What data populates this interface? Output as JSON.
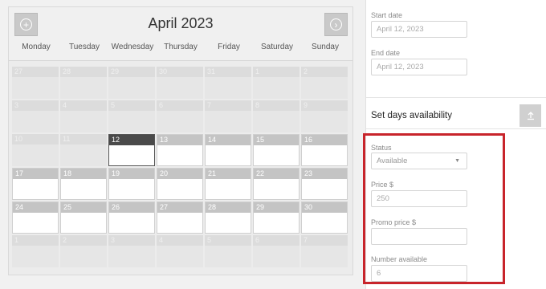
{
  "calendar": {
    "month_title": "April 2023",
    "prev_icon": "circle-plus-icon",
    "next_icon": "circle-arrow-right-icon",
    "weekdays": [
      "Monday",
      "Tuesday",
      "Wednesday",
      "Thursday",
      "Friday",
      "Saturday",
      "Sunday"
    ],
    "weeks": [
      [
        {
          "d": "27",
          "s": "muted"
        },
        {
          "d": "28",
          "s": "muted"
        },
        {
          "d": "29",
          "s": "muted"
        },
        {
          "d": "30",
          "s": "muted"
        },
        {
          "d": "31",
          "s": "muted"
        },
        {
          "d": "1",
          "s": "muted"
        },
        {
          "d": "2",
          "s": "muted"
        }
      ],
      [
        {
          "d": "3",
          "s": "muted"
        },
        {
          "d": "4",
          "s": "muted"
        },
        {
          "d": "5",
          "s": "muted"
        },
        {
          "d": "6",
          "s": "muted"
        },
        {
          "d": "7",
          "s": "muted"
        },
        {
          "d": "8",
          "s": "muted"
        },
        {
          "d": "9",
          "s": "muted"
        }
      ],
      [
        {
          "d": "10",
          "s": "muted"
        },
        {
          "d": "11",
          "s": "muted"
        },
        {
          "d": "12",
          "s": "today"
        },
        {
          "d": "13",
          "s": "active"
        },
        {
          "d": "14",
          "s": "active"
        },
        {
          "d": "15",
          "s": "active"
        },
        {
          "d": "16",
          "s": "active"
        }
      ],
      [
        {
          "d": "17",
          "s": "active"
        },
        {
          "d": "18",
          "s": "active"
        },
        {
          "d": "19",
          "s": "active"
        },
        {
          "d": "20",
          "s": "active"
        },
        {
          "d": "21",
          "s": "active"
        },
        {
          "d": "22",
          "s": "active"
        },
        {
          "d": "23",
          "s": "active"
        }
      ],
      [
        {
          "d": "24",
          "s": "active"
        },
        {
          "d": "25",
          "s": "active"
        },
        {
          "d": "26",
          "s": "active"
        },
        {
          "d": "27",
          "s": "active"
        },
        {
          "d": "28",
          "s": "active"
        },
        {
          "d": "29",
          "s": "active"
        },
        {
          "d": "30",
          "s": "active"
        }
      ],
      [
        {
          "d": "1",
          "s": "muted"
        },
        {
          "d": "2",
          "s": "muted"
        },
        {
          "d": "3",
          "s": "muted"
        },
        {
          "d": "4",
          "s": "muted"
        },
        {
          "d": "5",
          "s": "muted"
        },
        {
          "d": "6",
          "s": "muted"
        },
        {
          "d": "7",
          "s": "muted"
        }
      ]
    ]
  },
  "panel": {
    "start_date": {
      "label": "Start date",
      "value": "April 12, 2023"
    },
    "end_date": {
      "label": "End date",
      "value": "April 12, 2023"
    },
    "section_title": "Set days availability",
    "section_icon": "upload-icon",
    "status": {
      "label": "Status",
      "value": "Available",
      "icon": "dropdown-arrow-icon"
    },
    "price": {
      "label": "Price $",
      "value": "250"
    },
    "promo_price": {
      "label": "Promo price $",
      "value": ""
    },
    "number_available": {
      "label": "Number available",
      "value": "6"
    }
  },
  "colors": {
    "highlight_border": "#c8242b",
    "today": "#4a4a4a"
  }
}
